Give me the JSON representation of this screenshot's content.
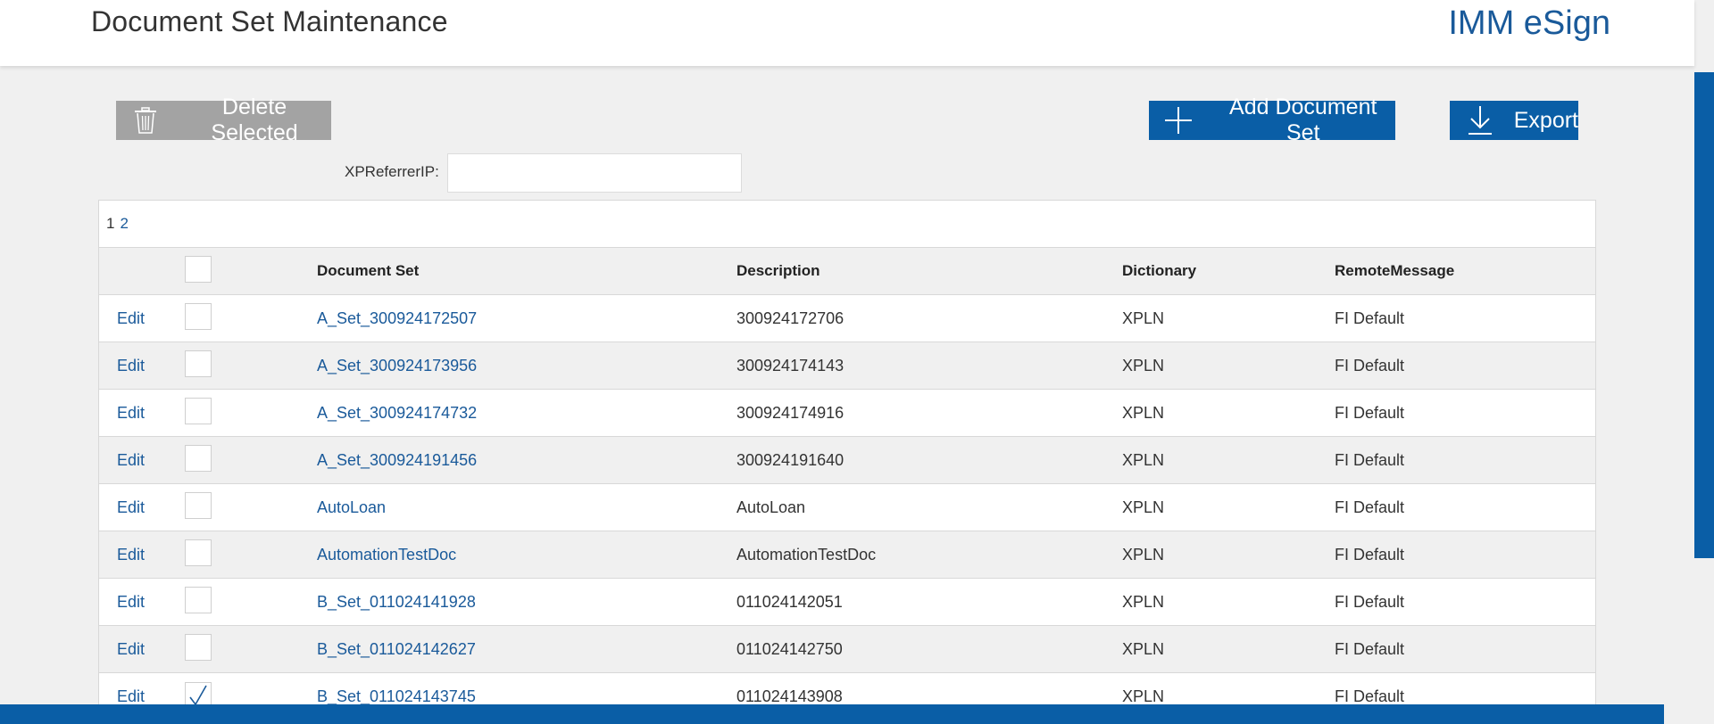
{
  "header": {
    "title": "Document Set Maintenance",
    "brand": "IMM eSign"
  },
  "toolbar": {
    "delete_label": "Delete Selected",
    "delete_icon": "trash-icon",
    "add_label": "Add Document Set",
    "add_icon": "plus-icon",
    "export_label": "Export",
    "export_icon": "download-icon"
  },
  "filter": {
    "label": "XPReferrerIP:",
    "value": ""
  },
  "pager": {
    "current": "1",
    "pages": [
      "2"
    ]
  },
  "table": {
    "columns": [
      "Document Set",
      "Description",
      "Dictionary",
      "RemoteMessage"
    ],
    "edit_label": "Edit",
    "rows": [
      {
        "set": "A_Set_300924172507",
        "description": "300924172706",
        "dictionary": "XPLN",
        "message": "FI Default",
        "checked": false
      },
      {
        "set": "A_Set_300924173956",
        "description": "300924174143",
        "dictionary": "XPLN",
        "message": "FI Default",
        "checked": false
      },
      {
        "set": "A_Set_300924174732",
        "description": "300924174916",
        "dictionary": "XPLN",
        "message": "FI Default",
        "checked": false
      },
      {
        "set": "A_Set_300924191456",
        "description": "300924191640",
        "dictionary": "XPLN",
        "message": "FI Default",
        "checked": false
      },
      {
        "set": "AutoLoan",
        "description": "AutoLoan",
        "dictionary": "XPLN",
        "message": "FI Default",
        "checked": false
      },
      {
        "set": "AutomationTestDoc",
        "description": "AutomationTestDoc",
        "dictionary": "XPLN",
        "message": "FI Default",
        "checked": false
      },
      {
        "set": "B_Set_011024141928",
        "description": "011024142051",
        "dictionary": "XPLN",
        "message": "FI Default",
        "checked": false
      },
      {
        "set": "B_Set_011024142627",
        "description": "011024142750",
        "dictionary": "XPLN",
        "message": "FI Default",
        "checked": false
      },
      {
        "set": "B_Set_011024143745",
        "description": "011024143908",
        "dictionary": "XPLN",
        "message": "FI Default",
        "checked": true
      }
    ]
  },
  "colors": {
    "accent": "#0a5ea6",
    "link": "#1a5a9a",
    "delete_disabled": "#a3a3a3",
    "background": "#f0f0f0"
  }
}
